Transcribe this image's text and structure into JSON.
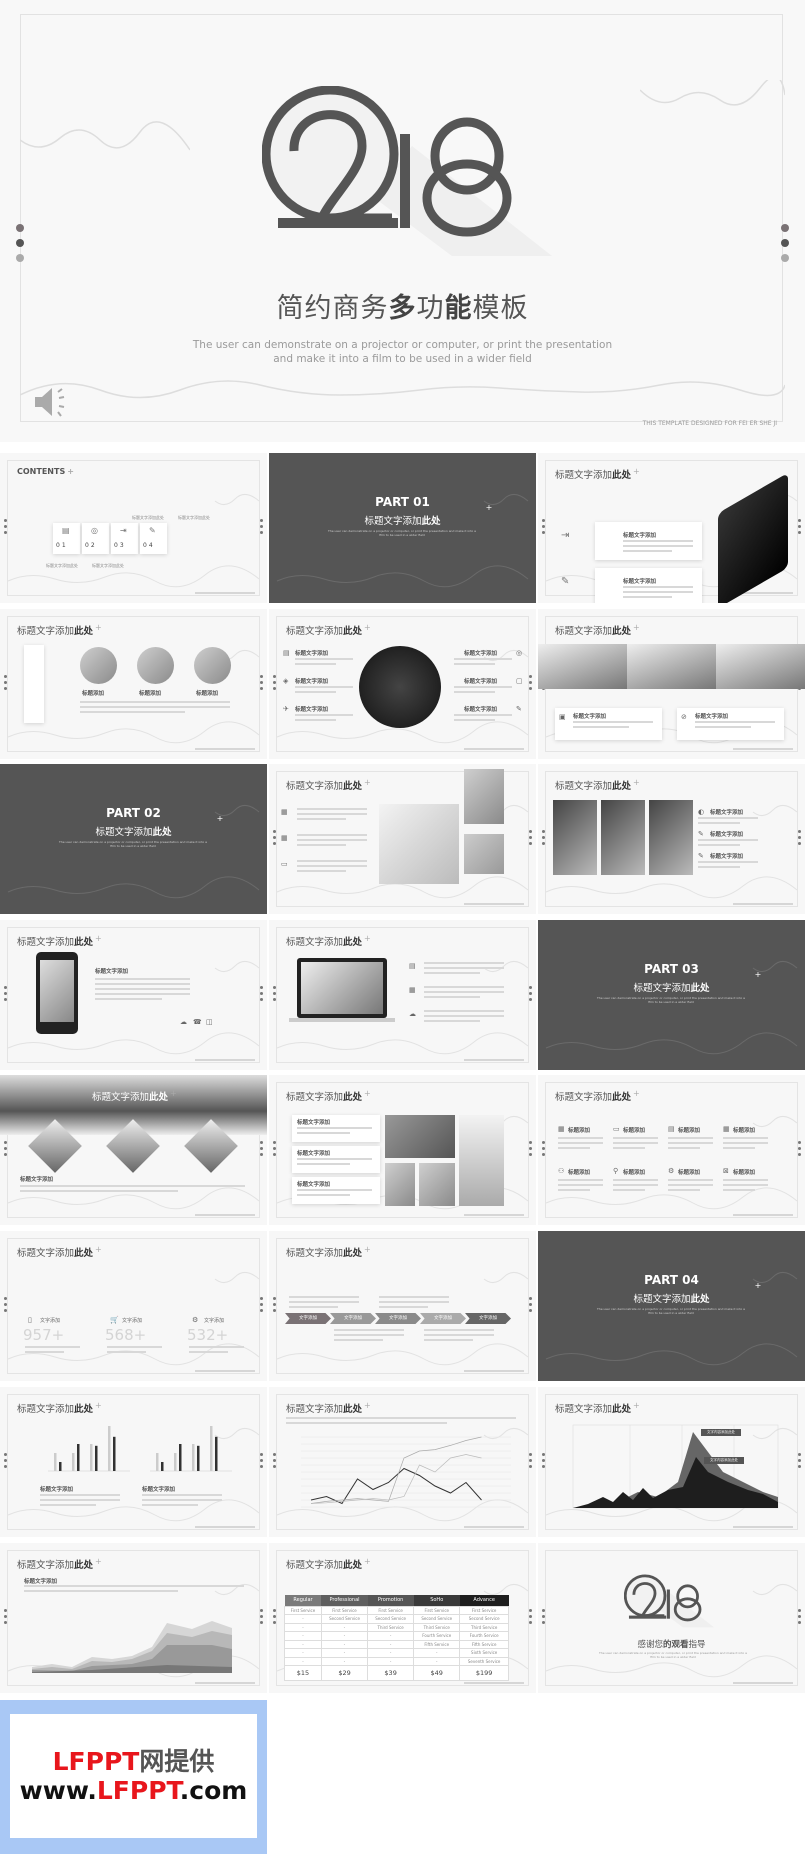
{
  "hero": {
    "title_plain": "简约商务",
    "title_bold1": "多",
    "title_mid": "功",
    "title_bold2": "能",
    "title_end": "模板",
    "subtitle_line1": "The user can demonstrate on a projector or computer, or print the presentation",
    "subtitle_line2": "and make it into a film to be used in a wider field",
    "footer": "THIS TEMPLATE DESIGNED FOR FEI ER SHE JI",
    "logo_text": "2018",
    "icons": [
      "speaker-icon"
    ]
  },
  "colors": {
    "dark": "#555555",
    "light": "#f7f7f7",
    "banner": "#a9c8f5",
    "brand_red": "#e8161c"
  },
  "common": {
    "slide_title": "标题文字添加",
    "slide_title_bold": "此处",
    "item_title": "标题文字添加",
    "short_label": "标题添加",
    "word_label": "文字添加",
    "plus": "+",
    "part_sub": "The user can demonstrate on a projector or computer, or print the presentation and make it into a film to be used in a wider field"
  },
  "contents": {
    "title": "CONTENTS",
    "items": [
      "01",
      "02",
      "03",
      "04"
    ],
    "labels": [
      "标题文字添加此处",
      "标题文字添加此处",
      "标题文字添加此处",
      "标题文字添加此处"
    ]
  },
  "parts": [
    "PART 01",
    "PART 02",
    "PART 03",
    "PART 04"
  ],
  "stats": [
    {
      "icon": "bin-icon",
      "label": "文字添加",
      "value": "957+"
    },
    {
      "icon": "cart-icon",
      "label": "文字添加",
      "value": "568+"
    },
    {
      "icon": "gear-icon",
      "label": "文字添加",
      "value": "532+"
    }
  ],
  "timeline": [
    "文字添加",
    "文字添加",
    "文字添加",
    "文字添加",
    "文字添加"
  ],
  "bar_charts": [
    {
      "series": [
        [
          2,
          1
        ],
        [
          2,
          3
        ],
        [
          3,
          2.8
        ],
        [
          5,
          3.8
        ]
      ]
    },
    {
      "series": [
        [
          2,
          1
        ],
        [
          2,
          3
        ],
        [
          3,
          2.8
        ],
        [
          5,
          3.8
        ]
      ]
    }
  ],
  "line_chart": {
    "series": [
      [
        10,
        15,
        5,
        40,
        25,
        35,
        55,
        45,
        30,
        20,
        35,
        10
      ],
      [
        5,
        8,
        10,
        12,
        10,
        8,
        70,
        80,
        82,
        88,
        95,
        100
      ],
      [
        5,
        6,
        8,
        10,
        12,
        10,
        15,
        60,
        50,
        70,
        75,
        70
      ]
    ]
  },
  "area_chart_callouts": [
    "文字内容添加此处",
    "文字内容添加此处"
  ],
  "pricing": {
    "headers": [
      "Regular",
      "Professional",
      "Promotion",
      "SoHo",
      "Advance"
    ],
    "header_colors": [
      "#7a7a7a",
      "#5f5f5f",
      "#555555",
      "#3a3a3a",
      "#1e1e1e"
    ],
    "rows": [
      [
        "First Service",
        "First Service",
        "First Service",
        "First Service",
        "First Service"
      ],
      [
        "-",
        "Second Service",
        "Second Service",
        "Second Service",
        "Second Service"
      ],
      [
        "-",
        "-",
        "Third Service",
        "Third Service",
        "Third Service"
      ],
      [
        "-",
        "-",
        "-",
        "Fourth Service",
        "Fourth Service"
      ],
      [
        "-",
        "-",
        "-",
        "Fifth Service",
        "Fifth Service"
      ],
      [
        "-",
        "-",
        "-",
        "-",
        "Sixth Service"
      ],
      [
        "-",
        "-",
        "-",
        "-",
        "Seventh Service"
      ]
    ],
    "prices": [
      "$15",
      "$29",
      "$39",
      "$49",
      "$199"
    ]
  },
  "thanks": {
    "title_plain": "感谢您",
    "title_bold": "的观看",
    "title_end": "指导",
    "logo_text": "2018"
  },
  "banner": {
    "red_part": "LFPPT",
    "black_part": "网提供",
    "url_prefix": "www.",
    "url_red": "LFPPT",
    "url_suffix": ".com"
  }
}
